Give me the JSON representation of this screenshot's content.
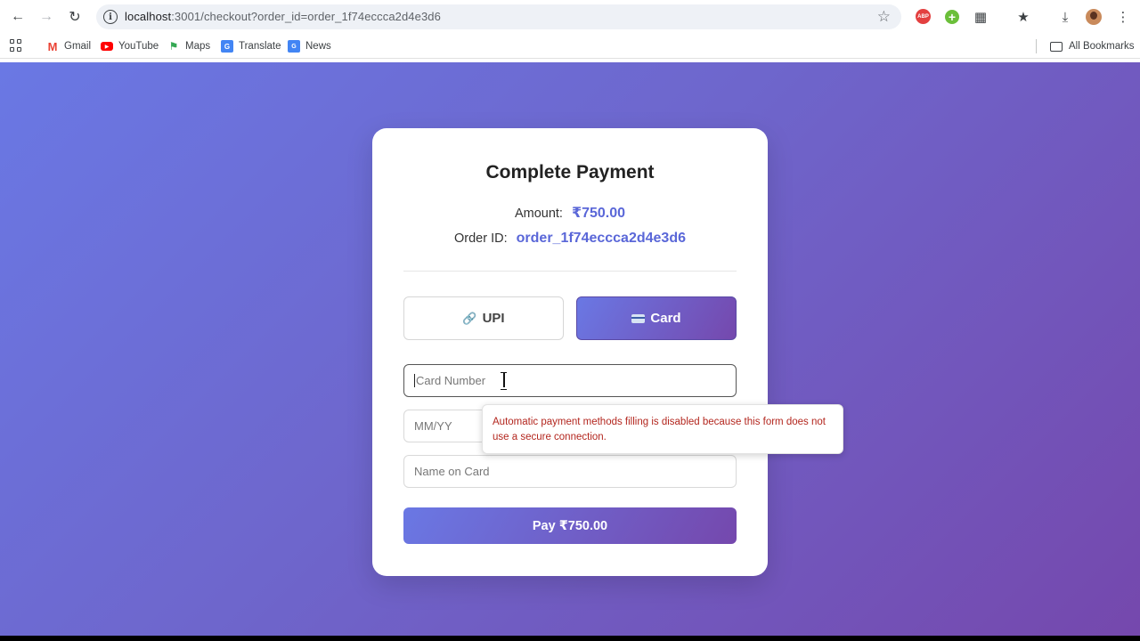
{
  "browser": {
    "url_host": "localhost",
    "url_rest": ":3001/checkout?order_id=order_1f74eccca2d4e3d6",
    "abp_label": "ABP",
    "bookmarks": [
      {
        "label": "Gmail",
        "icon": "gmail-icon"
      },
      {
        "label": "YouTube",
        "icon": "youtube-icon"
      },
      {
        "label": "Maps",
        "icon": "maps-icon"
      },
      {
        "label": "Translate",
        "icon": "translate-icon"
      },
      {
        "label": "News",
        "icon": "news-icon"
      }
    ],
    "all_bookmarks": "All Bookmarks"
  },
  "checkout": {
    "title": "Complete Payment",
    "amount_label": "Amount:",
    "amount_value": "₹750.00",
    "order_label": "Order ID:",
    "order_value": "order_1f74eccca2d4e3d6",
    "methods": {
      "upi": "UPI",
      "card": "Card",
      "selected": "card"
    },
    "fields": {
      "card_number_placeholder": "Card Number",
      "expiry_placeholder": "MM/YY",
      "name_placeholder": "Name on Card"
    },
    "pay_button": "Pay ₹750.00",
    "autofill_warning": "Automatic payment methods filling is disabled because this form does not use a secure connection."
  },
  "colors": {
    "accent": "#5a67d8",
    "gradient_start": "#6a78e4",
    "gradient_end": "#7548ad",
    "warning_text": "#b3261e"
  }
}
